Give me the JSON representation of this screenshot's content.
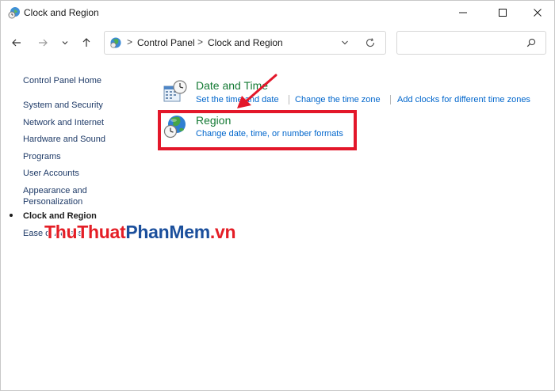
{
  "window": {
    "title": "Clock and Region"
  },
  "address_bar": {
    "crumbs": [
      "Control Panel",
      "Clock and Region"
    ],
    "separator": ">"
  },
  "search": {
    "placeholder": ""
  },
  "sidebar": {
    "home": "Control Panel Home",
    "items": [
      "System and Security",
      "Network and Internet",
      "Hardware and Sound",
      "Programs",
      "User Accounts",
      "Appearance and Personalization",
      "Clock and Region",
      "Ease of Access"
    ],
    "appearance_line1": "Appearance and",
    "appearance_line2": "Personalization",
    "active_item": "Clock and Region"
  },
  "categories": [
    {
      "title": "Date and Time",
      "icon": "calendar-clock-icon",
      "links": [
        "Set the time and date",
        "Change the time zone",
        "Add clocks for different time zones"
      ]
    },
    {
      "title": "Region",
      "icon": "globe-clock-icon",
      "links": [
        "Change date, time, or number formats"
      ]
    }
  ],
  "annotation": {
    "color": "#e3172a"
  },
  "watermark": {
    "part1": "ThuThuat",
    "part2": "PhanMem",
    "part3": ".vn"
  },
  "colors": {
    "category_title": "#147a34",
    "link": "#0066cc",
    "sidebar_link": "#1f3b68"
  }
}
